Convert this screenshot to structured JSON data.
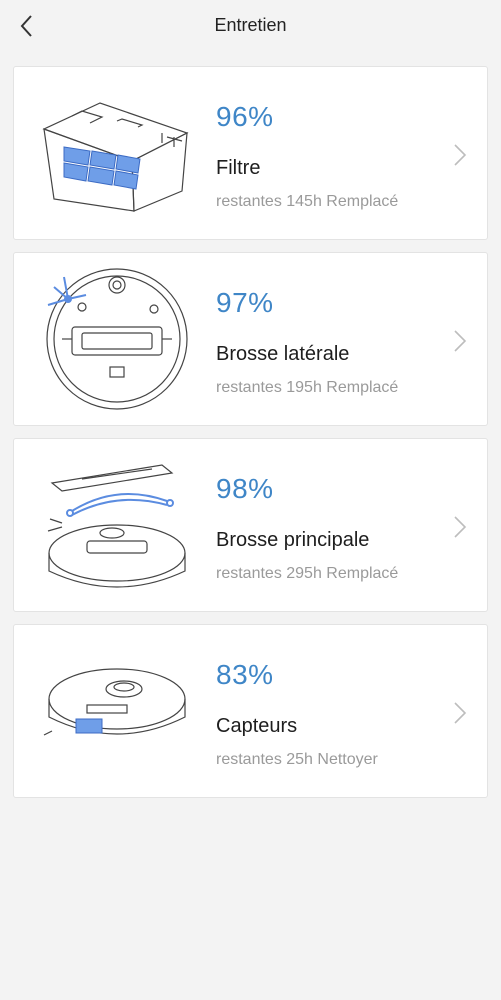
{
  "header": {
    "title": "Entretien",
    "back_icon": "chevron-left-icon"
  },
  "items": [
    {
      "percent": "96%",
      "label": "Filtre",
      "remaining": "restantes 145h Remplacé",
      "illustration": "filter-illustration"
    },
    {
      "percent": "97%",
      "label": "Brosse latérale",
      "remaining": "restantes 195h Remplacé",
      "illustration": "side-brush-illustration"
    },
    {
      "percent": "98%",
      "label": "Brosse principale",
      "remaining": "restantes 295h Remplacé",
      "illustration": "main-brush-illustration"
    },
    {
      "percent": "83%",
      "label": "Capteurs",
      "remaining": "restantes 25h Nettoyer",
      "illustration": "sensors-illustration"
    }
  ],
  "colors": {
    "accent": "#3f86c7",
    "background": "#f3f3f3",
    "card": "#ffffff",
    "text": "#1e1e1e",
    "muted": "#9a9a9a",
    "highlight": "#6f9ee8"
  }
}
